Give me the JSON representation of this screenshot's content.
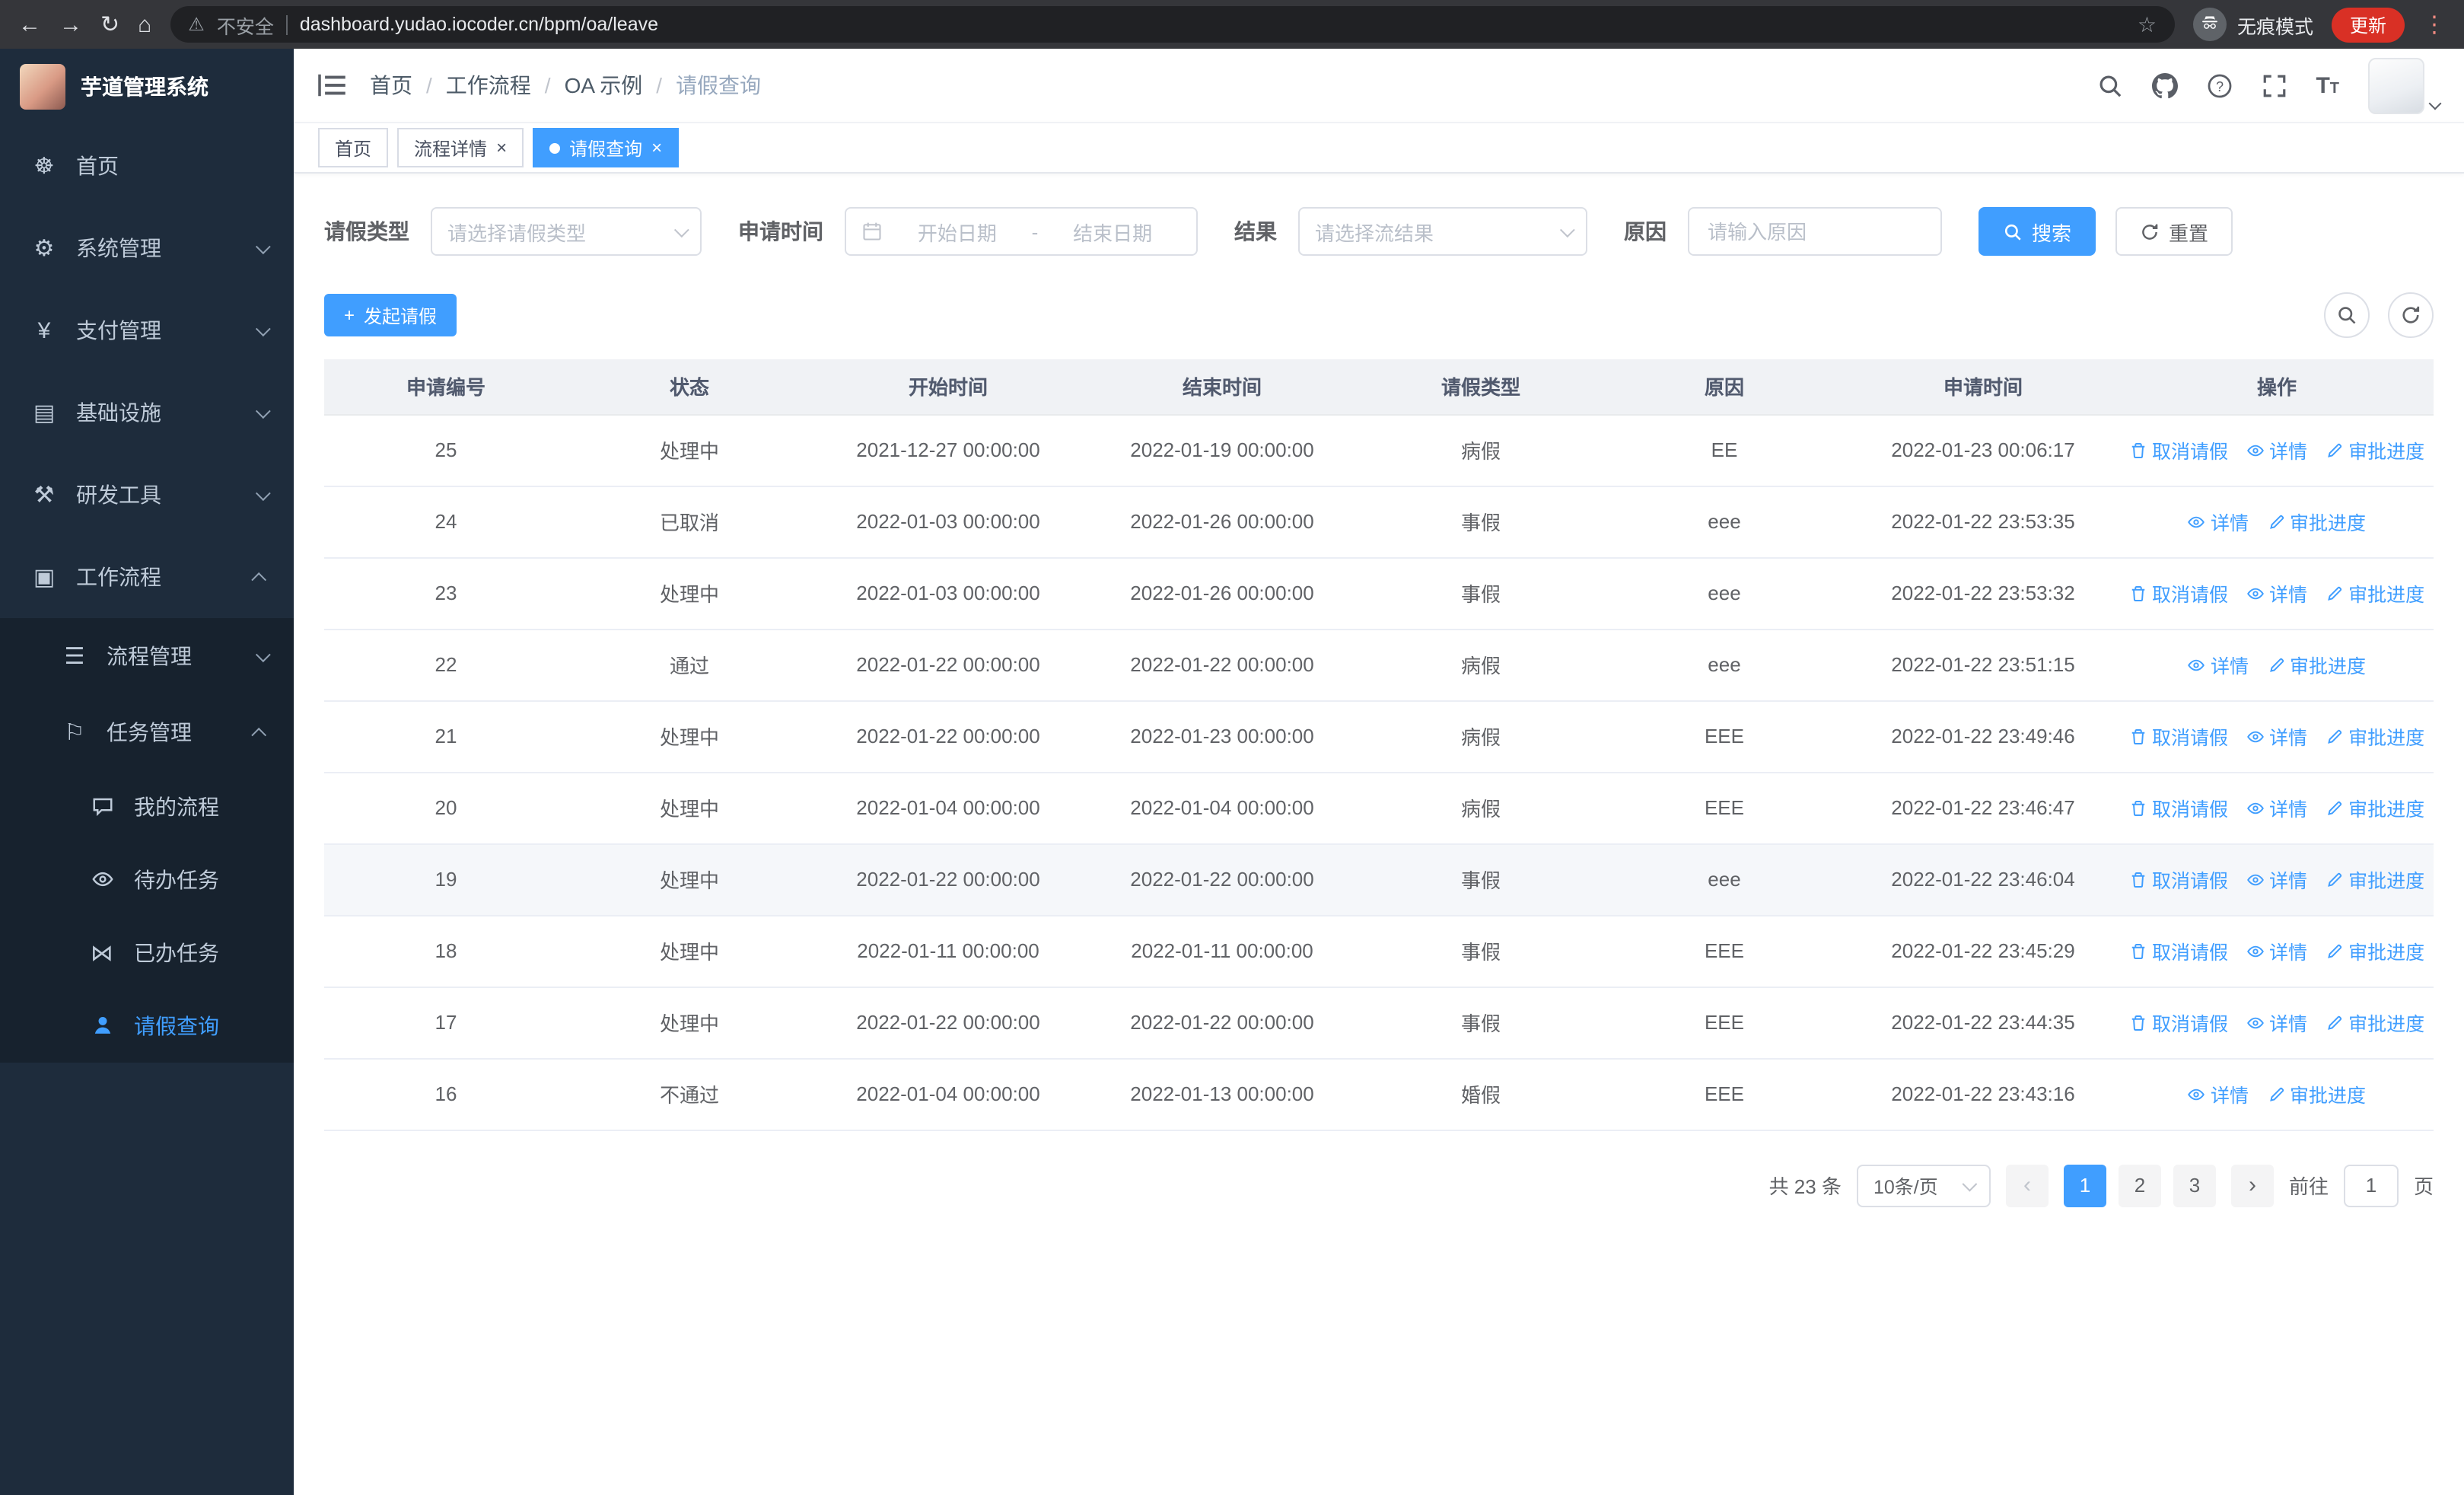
{
  "browser": {
    "security_label": "不安全",
    "url": "dashboard.yudao.iocoder.cn/bpm/oa/leave",
    "incognito_label": "无痕模式",
    "update_button": "更新"
  },
  "sidebar": {
    "logo": "芋道管理系统",
    "items": [
      {
        "label": "首页"
      },
      {
        "label": "系统管理"
      },
      {
        "label": "支付管理"
      },
      {
        "label": "基础设施"
      },
      {
        "label": "研发工具"
      },
      {
        "label": "工作流程"
      }
    ],
    "workflow_children": [
      {
        "label": "流程管理"
      },
      {
        "label": "任务管理"
      }
    ],
    "task_children": [
      {
        "label": "我的流程"
      },
      {
        "label": "待办任务"
      },
      {
        "label": "已办任务"
      },
      {
        "label": "请假查询"
      }
    ],
    "active_item": "请假查询"
  },
  "header": {
    "breadcrumb": [
      "首页",
      "工作流程",
      "OA 示例",
      "请假查询"
    ]
  },
  "tabs": [
    {
      "label": "首页"
    },
    {
      "label": "流程详情"
    },
    {
      "label": "请假查询"
    }
  ],
  "filters": {
    "leave_type_label": "请假类型",
    "leave_type_placeholder": "请选择请假类型",
    "apply_time_label": "申请时间",
    "start_date_placeholder": "开始日期",
    "range_separator": "-",
    "end_date_placeholder": "结束日期",
    "result_label": "结果",
    "result_placeholder": "请选择流结果",
    "reason_label": "原因",
    "reason_placeholder": "请输入原因",
    "search_button": "搜索",
    "reset_button": "重置"
  },
  "toolbar": {
    "create_button": "发起请假"
  },
  "table": {
    "columns": [
      "申请编号",
      "状态",
      "开始时间",
      "结束时间",
      "请假类型",
      "原因",
      "申请时间",
      "操作"
    ],
    "actions": {
      "cancel": "取消请假",
      "detail": "详情",
      "progress": "审批进度"
    },
    "rows": [
      {
        "id": "25",
        "status": "处理中",
        "start": "2021-12-27 00:00:00",
        "end": "2022-01-19 00:00:00",
        "type": "病假",
        "reason": "EE",
        "applied": "2022-01-23 00:06:17",
        "cancelable": true,
        "highlighted": false
      },
      {
        "id": "24",
        "status": "已取消",
        "start": "2022-01-03 00:00:00",
        "end": "2022-01-26 00:00:00",
        "type": "事假",
        "reason": "eee",
        "applied": "2022-01-22 23:53:35",
        "cancelable": false,
        "highlighted": false
      },
      {
        "id": "23",
        "status": "处理中",
        "start": "2022-01-03 00:00:00",
        "end": "2022-01-26 00:00:00",
        "type": "事假",
        "reason": "eee",
        "applied": "2022-01-22 23:53:32",
        "cancelable": true,
        "highlighted": false
      },
      {
        "id": "22",
        "status": "通过",
        "start": "2022-01-22 00:00:00",
        "end": "2022-01-22 00:00:00",
        "type": "病假",
        "reason": "eee",
        "applied": "2022-01-22 23:51:15",
        "cancelable": false,
        "highlighted": false
      },
      {
        "id": "21",
        "status": "处理中",
        "start": "2022-01-22 00:00:00",
        "end": "2022-01-23 00:00:00",
        "type": "病假",
        "reason": "EEE",
        "applied": "2022-01-22 23:49:46",
        "cancelable": true,
        "highlighted": false
      },
      {
        "id": "20",
        "status": "处理中",
        "start": "2022-01-04 00:00:00",
        "end": "2022-01-04 00:00:00",
        "type": "病假",
        "reason": "EEE",
        "applied": "2022-01-22 23:46:47",
        "cancelable": true,
        "highlighted": false
      },
      {
        "id": "19",
        "status": "处理中",
        "start": "2022-01-22 00:00:00",
        "end": "2022-01-22 00:00:00",
        "type": "事假",
        "reason": "eee",
        "applied": "2022-01-22 23:46:04",
        "cancelable": true,
        "highlighted": true
      },
      {
        "id": "18",
        "status": "处理中",
        "start": "2022-01-11 00:00:00",
        "end": "2022-01-11 00:00:00",
        "type": "事假",
        "reason": "EEE",
        "applied": "2022-01-22 23:45:29",
        "cancelable": true,
        "highlighted": false
      },
      {
        "id": "17",
        "status": "处理中",
        "start": "2022-01-22 00:00:00",
        "end": "2022-01-22 00:00:00",
        "type": "事假",
        "reason": "EEE",
        "applied": "2022-01-22 23:44:35",
        "cancelable": true,
        "highlighted": false
      },
      {
        "id": "16",
        "status": "不通过",
        "start": "2022-01-04 00:00:00",
        "end": "2022-01-13 00:00:00",
        "type": "婚假",
        "reason": "EEE",
        "applied": "2022-01-22 23:43:16",
        "cancelable": false,
        "highlighted": false
      }
    ]
  },
  "pagination": {
    "total_label": "共 23 条",
    "page_size": "10条/页",
    "pages": [
      "1",
      "2",
      "3"
    ],
    "current": "1",
    "goto_label": "前往",
    "goto_value": "1",
    "page_unit": "页"
  },
  "colors": {
    "primary": "#409eff",
    "sidebar_bg": "#1e2c3c",
    "sidebar_submenu_bg": "#17222e",
    "menu_text": "#bfcbd9",
    "update_badge": "#d93025"
  }
}
